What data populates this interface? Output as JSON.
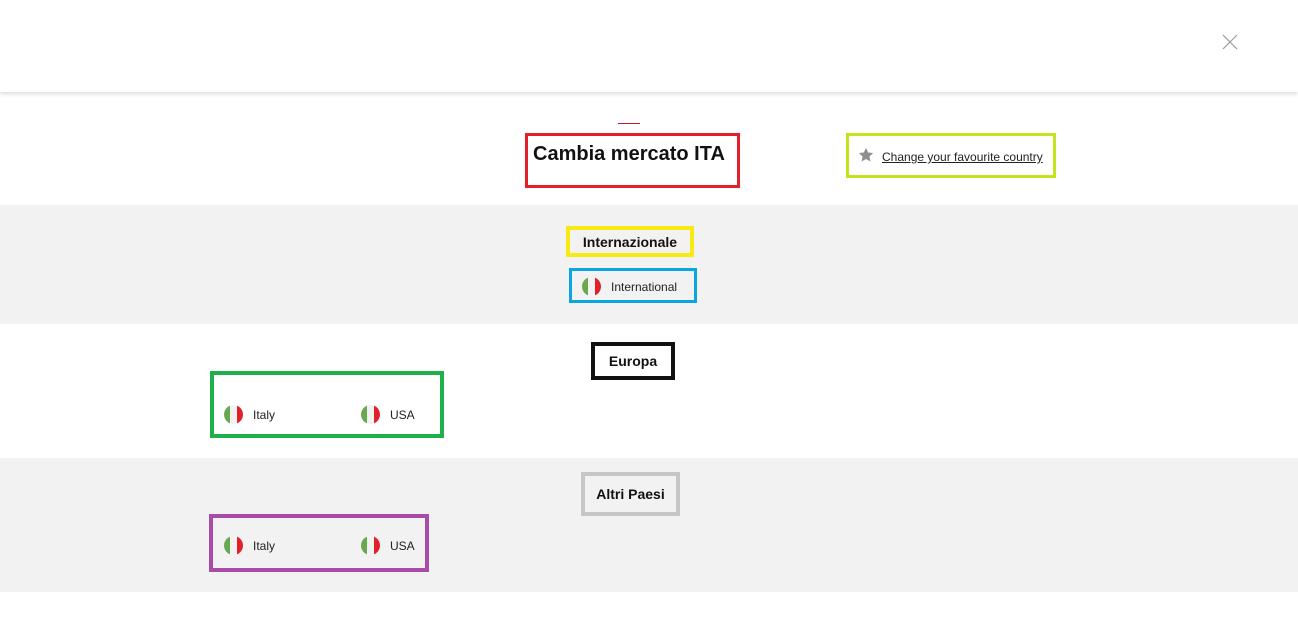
{
  "header": {
    "close_icon": "close-x-icon"
  },
  "title": {
    "text": "Cambia mercato ITA"
  },
  "favourite": {
    "icon": "star-icon",
    "label": "Change your favourite country"
  },
  "sections": {
    "international": {
      "title": "Internazionale",
      "items": [
        {
          "label": "International",
          "flag": "italy-flag"
        }
      ]
    },
    "europe": {
      "title": "Europa",
      "items": [
        {
          "label": "Italy",
          "flag": "italy-flag"
        },
        {
          "label": "USA",
          "flag": "italy-flag"
        }
      ]
    },
    "other": {
      "title": "Altri Paesi",
      "items": [
        {
          "label": "Italy",
          "flag": "italy-flag"
        },
        {
          "label": "USA",
          "flag": "italy-flag"
        }
      ]
    }
  },
  "colors": {
    "flag_green": "#6aa84f",
    "flag_white": "#f2f2f2",
    "flag_red": "#e0202a",
    "accent": "#b3202a",
    "band_grey": "#f2f2f2"
  }
}
